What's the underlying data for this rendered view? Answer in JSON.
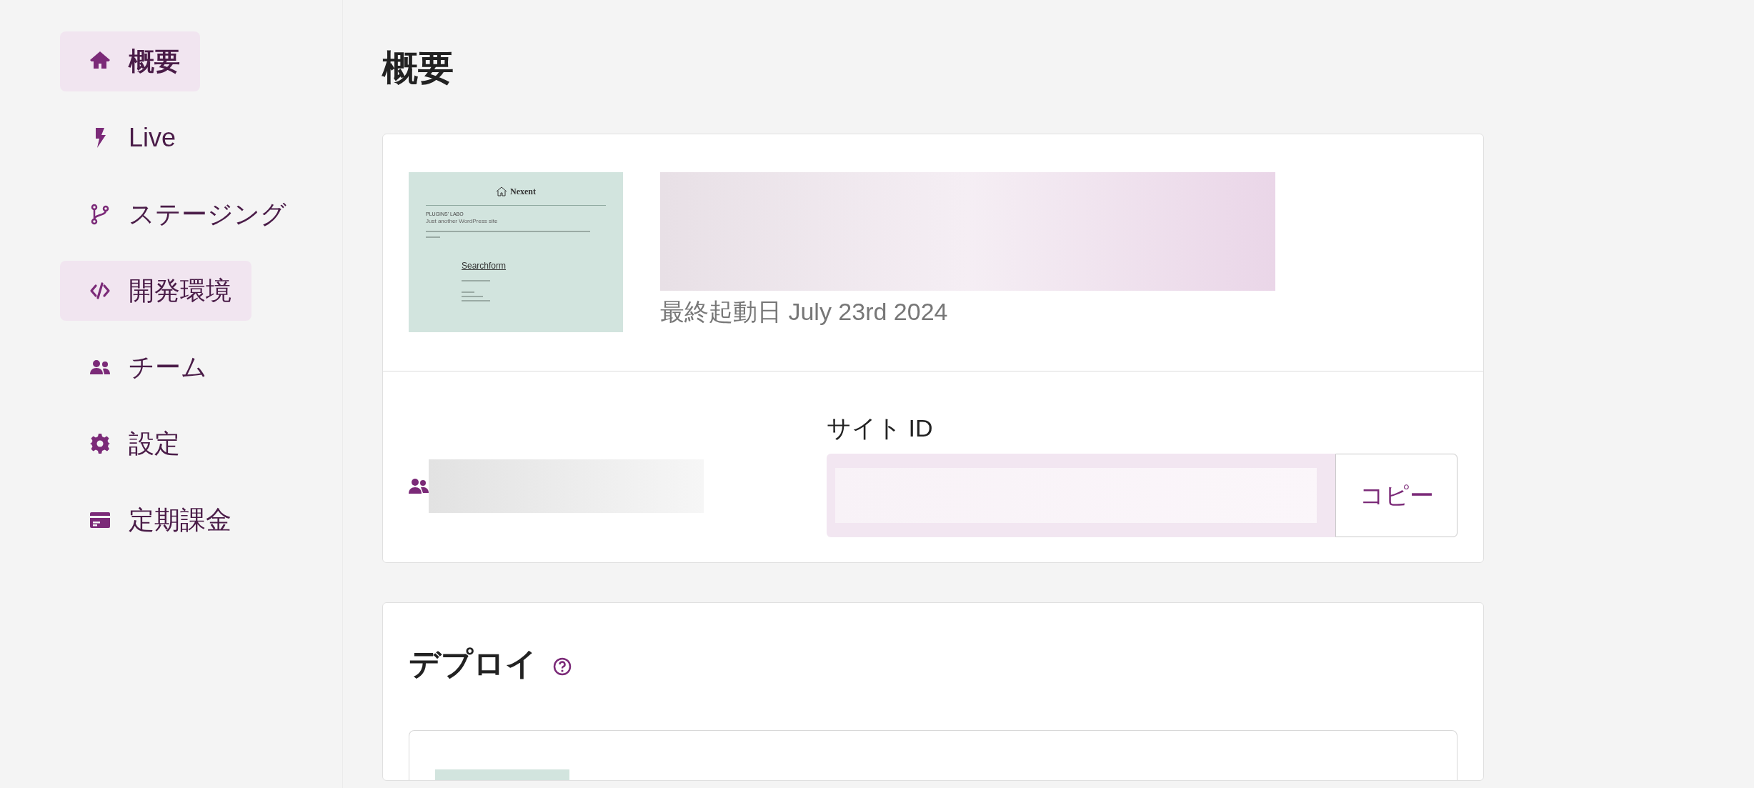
{
  "sidebar": {
    "items": [
      {
        "label": "概要",
        "kind": "home",
        "selected": true,
        "highlighted": true
      },
      {
        "label": "Live",
        "kind": "bolt",
        "selected": false,
        "highlighted": false
      },
      {
        "label": "ステージング",
        "kind": "branch",
        "selected": false,
        "highlighted": false
      },
      {
        "label": "開発環境",
        "kind": "code",
        "selected": false,
        "highlighted": true
      },
      {
        "label": "チーム",
        "kind": "users",
        "selected": false,
        "highlighted": false
      },
      {
        "label": "設定",
        "kind": "gear",
        "selected": false,
        "highlighted": false
      },
      {
        "label": "定期課金",
        "kind": "card",
        "selected": false,
        "highlighted": false
      }
    ]
  },
  "page": {
    "title": "概要"
  },
  "overview": {
    "preview": {
      "logo": "Nexent",
      "site_title": "PLUGINS' LABO",
      "tagline": "Just another WordPress site",
      "heading": "Searchform"
    },
    "last_started": "最終起動日 July 23rd 2024",
    "site_id": {
      "label": "サイト ID",
      "copy_button": "コピー"
    }
  },
  "deploy": {
    "title": "デプロイ"
  }
}
